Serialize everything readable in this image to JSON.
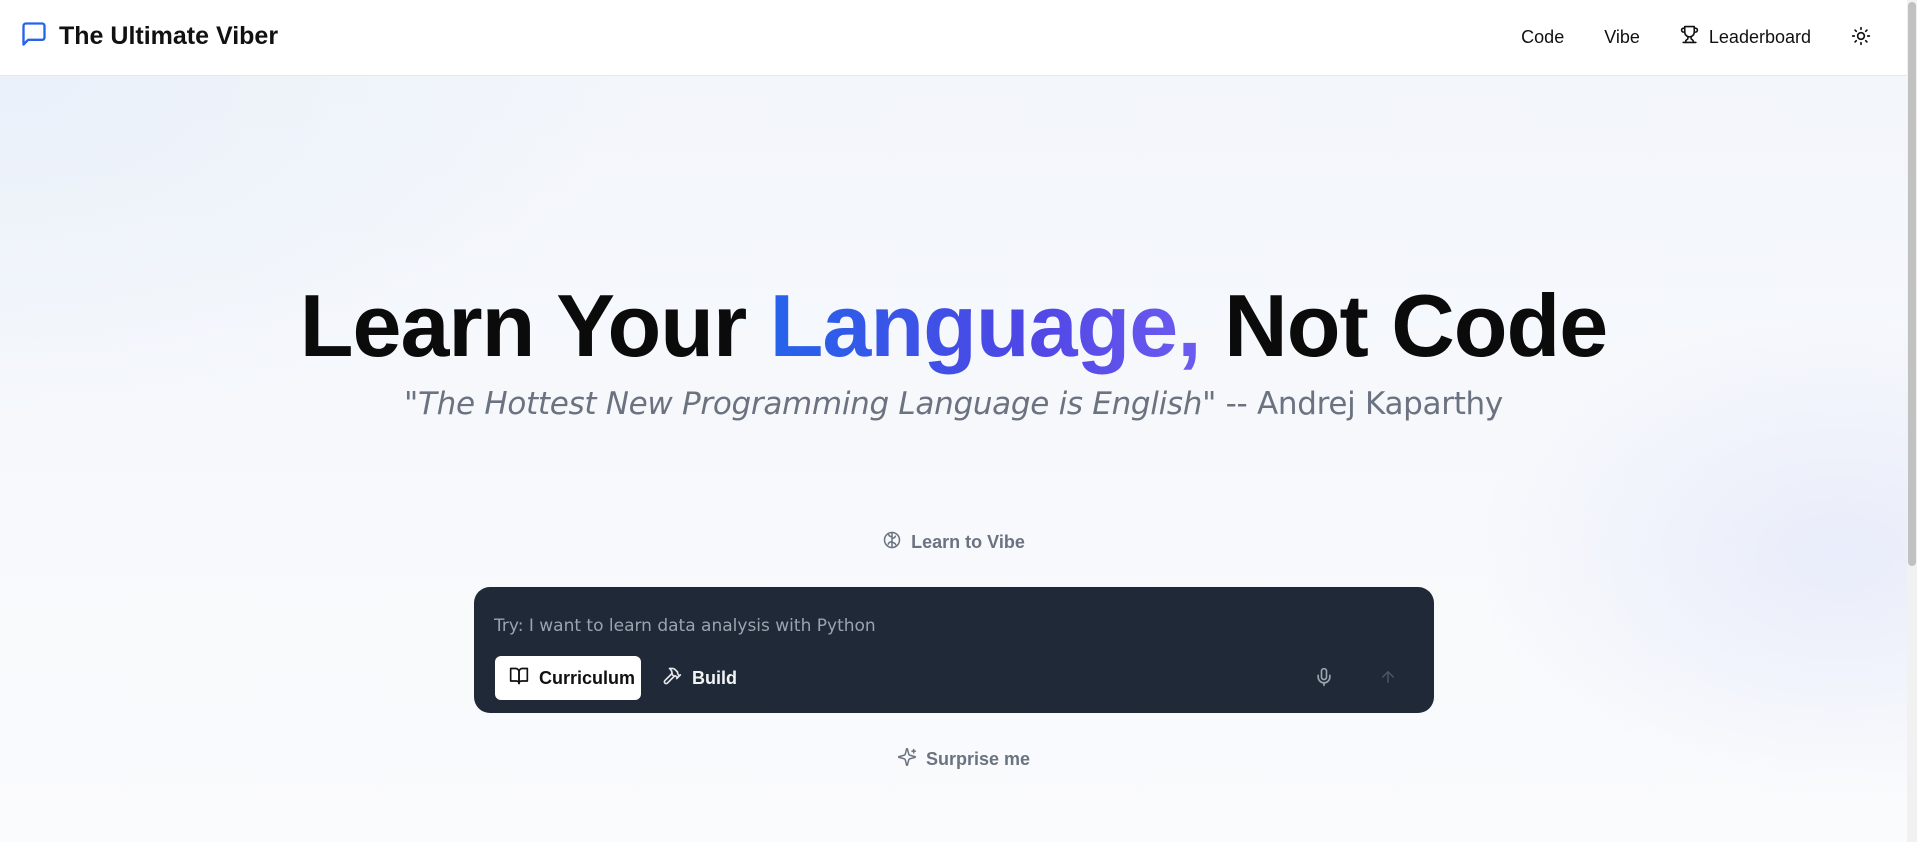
{
  "header": {
    "brand_title": "The Ultimate Viber",
    "brand_icon": "message-square-icon",
    "nav": [
      {
        "label": "Code"
      },
      {
        "label": "Vibe"
      },
      {
        "label": "Leaderboard",
        "icon": "trophy-icon"
      }
    ],
    "theme_icon": "sun-icon"
  },
  "hero": {
    "headline_before": "Learn Your ",
    "headline_accent": "Language,",
    "headline_after": " Not Code",
    "quote_open": "\"",
    "quote_italic": "The Hottest New Programming Language is English",
    "quote_close": "\" -- Andrej Kaparthy"
  },
  "learn_label": {
    "text": "Learn to Vibe",
    "icon": "brain-icon"
  },
  "composer": {
    "placeholder": "Try: I want to learn data analysis with Python",
    "value": "",
    "modes": [
      {
        "label": "Curriculum",
        "icon": "book-open-icon",
        "selected": true
      },
      {
        "label": "Build",
        "icon": "hammer-icon",
        "selected": false
      }
    ],
    "mic_icon": "mic-icon",
    "send_icon": "arrow-up-icon"
  },
  "surprise": {
    "label": "Surprise me",
    "icon": "sparkles-icon"
  },
  "colors": {
    "accent_start": "#2563eb",
    "accent_end": "#4f46e5",
    "composer_bg": "#1f2937",
    "brand_icon": "#2563eb"
  }
}
